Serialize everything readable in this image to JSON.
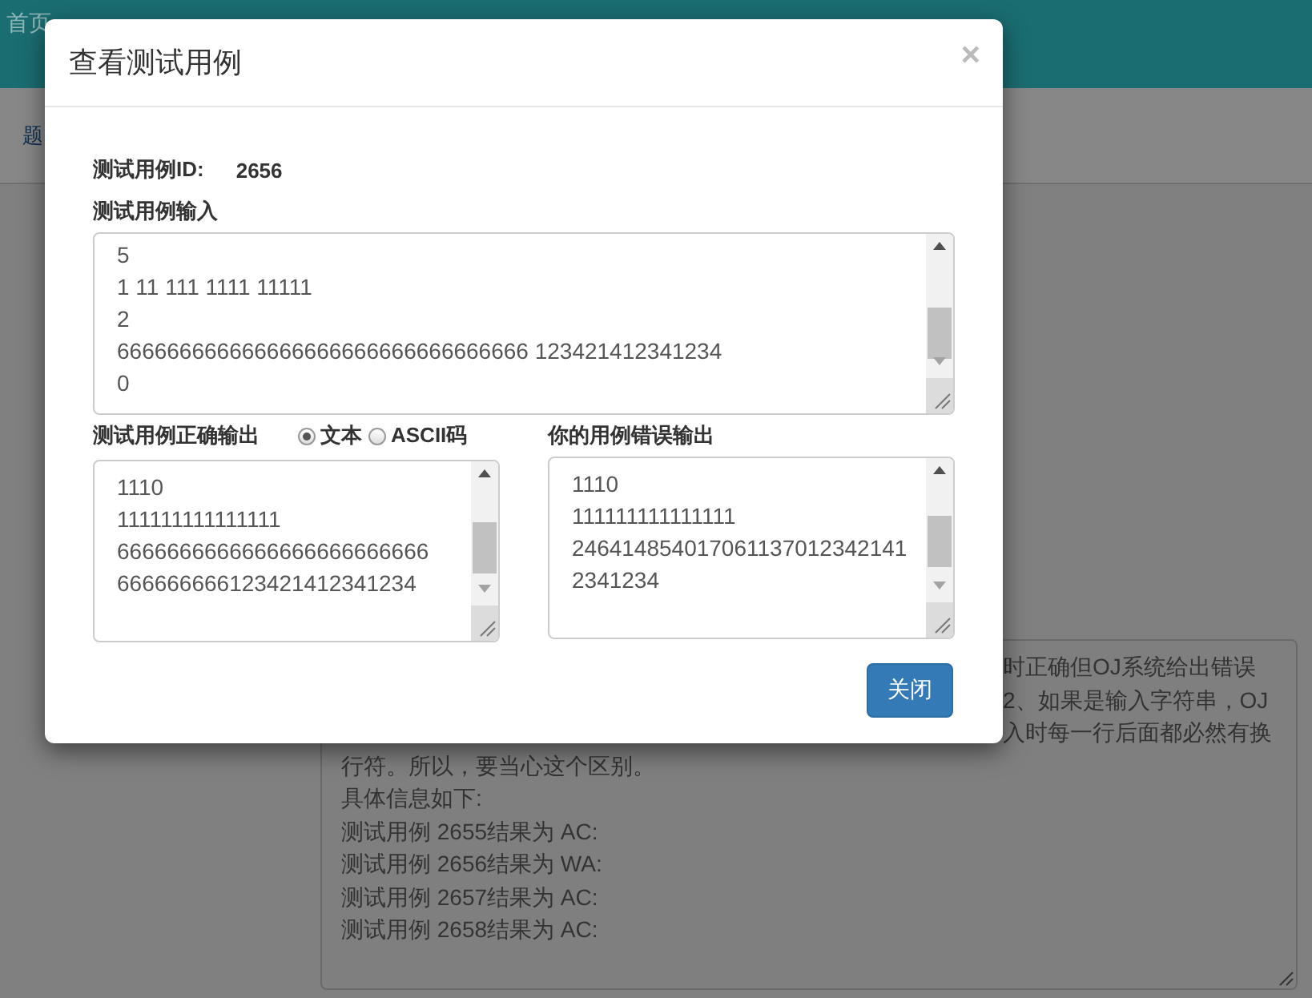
{
  "navbar": {
    "items": [
      {
        "label": "首页"
      }
    ]
  },
  "subnav": {
    "items": [
      {
        "label": "题"
      }
    ]
  },
  "result_box": {
    "line_ends_beside_dialog": [
      "时正确但OJ系统给出错误",
      "2、如果是输入字符串，OJ",
      "入时每一行后面都必然有换"
    ],
    "lines": [
      "行符。所以，要当心这个区别。",
      "具体信息如下:",
      "测试用例 2655结果为 AC:",
      "测试用例 2656结果为 WA:",
      "测试用例 2657结果为 AC:",
      "测试用例 2658结果为 AC:"
    ]
  },
  "modal": {
    "title": "查看测试用例",
    "close": "×",
    "id_label": "测试用例ID:",
    "id_value": "2656",
    "input": {
      "label": "测试用例输入",
      "lines": [
        "5",
        "1 11 111 1111 11111",
        "2",
        "666666666666666666666666666666666 123421412341234",
        "0"
      ]
    },
    "expected": {
      "label": "测试用例正确输出",
      "lines": [
        "1110",
        "111111111111111",
        "6666666666666666666666666",
        "666666666123421412341234"
      ]
    },
    "format_options": [
      {
        "label": "文本",
        "selected": true
      },
      {
        "label": "ASCII码",
        "selected": false
      }
    ],
    "actual": {
      "label": "你的用例错误输出",
      "lines": [
        "1110",
        "111111111111111",
        "246414854017061137012342141",
        "2341234"
      ]
    },
    "button": "关闭"
  }
}
